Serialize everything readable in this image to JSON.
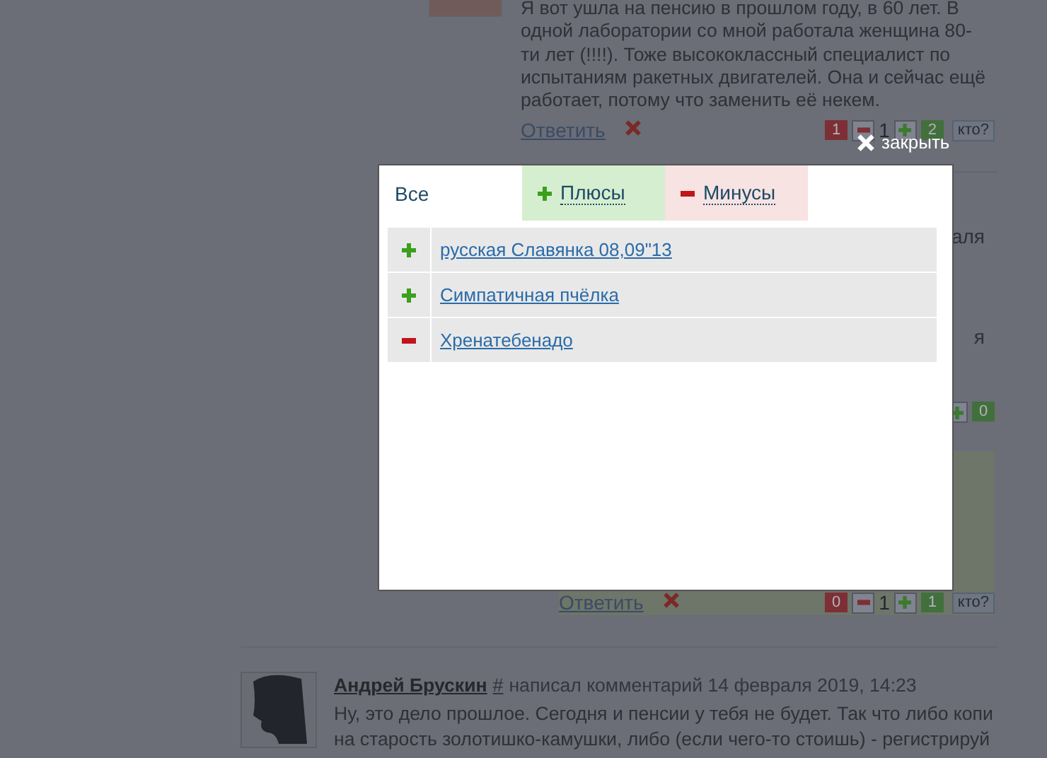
{
  "top_comment": {
    "text": "Я вот ушла на пенсию в прошлом году, в 60 лет. В одной лаборатории со мной работала женщина 80-ти лет (!!!!). Тоже высококлассный специалист по испытаниям ракетных двигателей. Она и сейчас ещё работает, потому что заменить её некем.",
    "reply_link": "Ответить",
    "votes": {
      "minus_total": "1",
      "rating": "1",
      "plus_total": "2",
      "who_button": "кто?"
    }
  },
  "hidden_fragments": [
    "аля",
    "я"
  ],
  "partial_votes": {
    "plus_total": "0"
  },
  "highlighted_comment": {
    "reply_link": "Ответить",
    "votes": {
      "minus_total": "0",
      "rating": "1",
      "plus_total": "1",
      "who_button": "кто?"
    }
  },
  "next_comment": {
    "author": "Андрей Брускин",
    "anchor": "#",
    "meta": "написал комментарий 14 февраля 2019, 14:23",
    "text": "Ну, это дело прошлое. Сегодня и пенсии у тебя не будет. Так что либо копи на старость золотишко-камушки, либо (если чего-то стоишь) - регистрируй"
  },
  "modal": {
    "close": "закрыть",
    "tabs": [
      {
        "label": "Все",
        "kind": "all",
        "selected": true
      },
      {
        "label": "Плюсы",
        "kind": "plus",
        "selected": false
      },
      {
        "label": "Минусы",
        "kind": "minus",
        "selected": false
      }
    ],
    "voters": [
      {
        "name": "русская Славянка 08,09\"13",
        "kind": "plus"
      },
      {
        "name": "Симпатичная пчёлка",
        "kind": "plus"
      },
      {
        "name": "Хренатебенадо",
        "kind": "minus"
      }
    ]
  }
}
